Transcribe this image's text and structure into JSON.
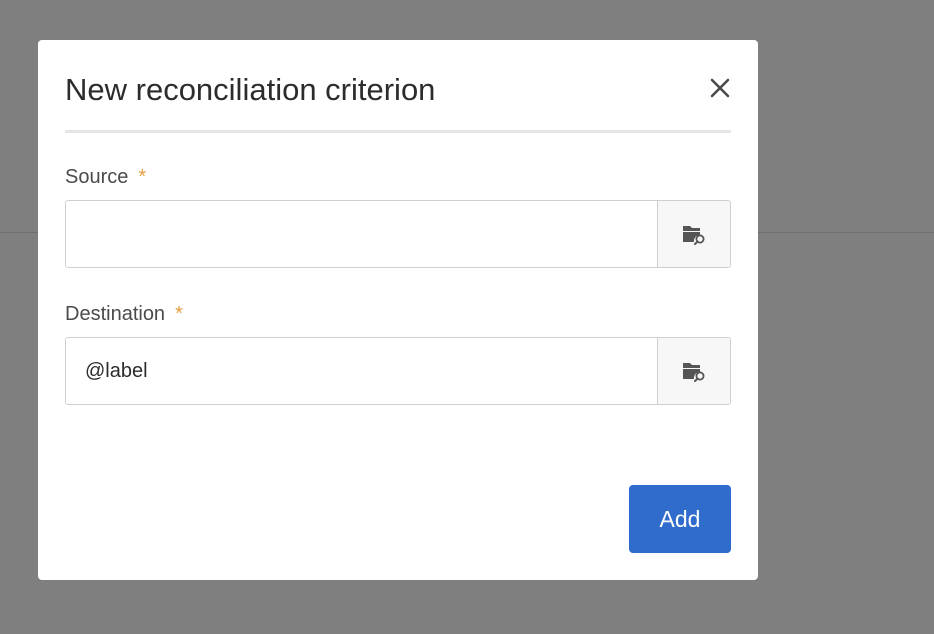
{
  "dialog": {
    "title": "New reconciliation criterion",
    "close_icon": "close-icon",
    "fields": [
      {
        "label": "Source",
        "required_mark": "*",
        "value": "",
        "placeholder": "",
        "browse_icon": "folder-search-icon"
      },
      {
        "label": "Destination",
        "required_mark": "*",
        "value": "@label",
        "placeholder": "",
        "browse_icon": "folder-search-icon"
      }
    ],
    "add_label": "Add"
  },
  "colors": {
    "backdrop": "#7f7f7f",
    "dialog_background": "#ffffff",
    "primary_button": "#2f6ccc",
    "required_mark": "#e59f3f",
    "title_text": "#2c2c2c"
  }
}
